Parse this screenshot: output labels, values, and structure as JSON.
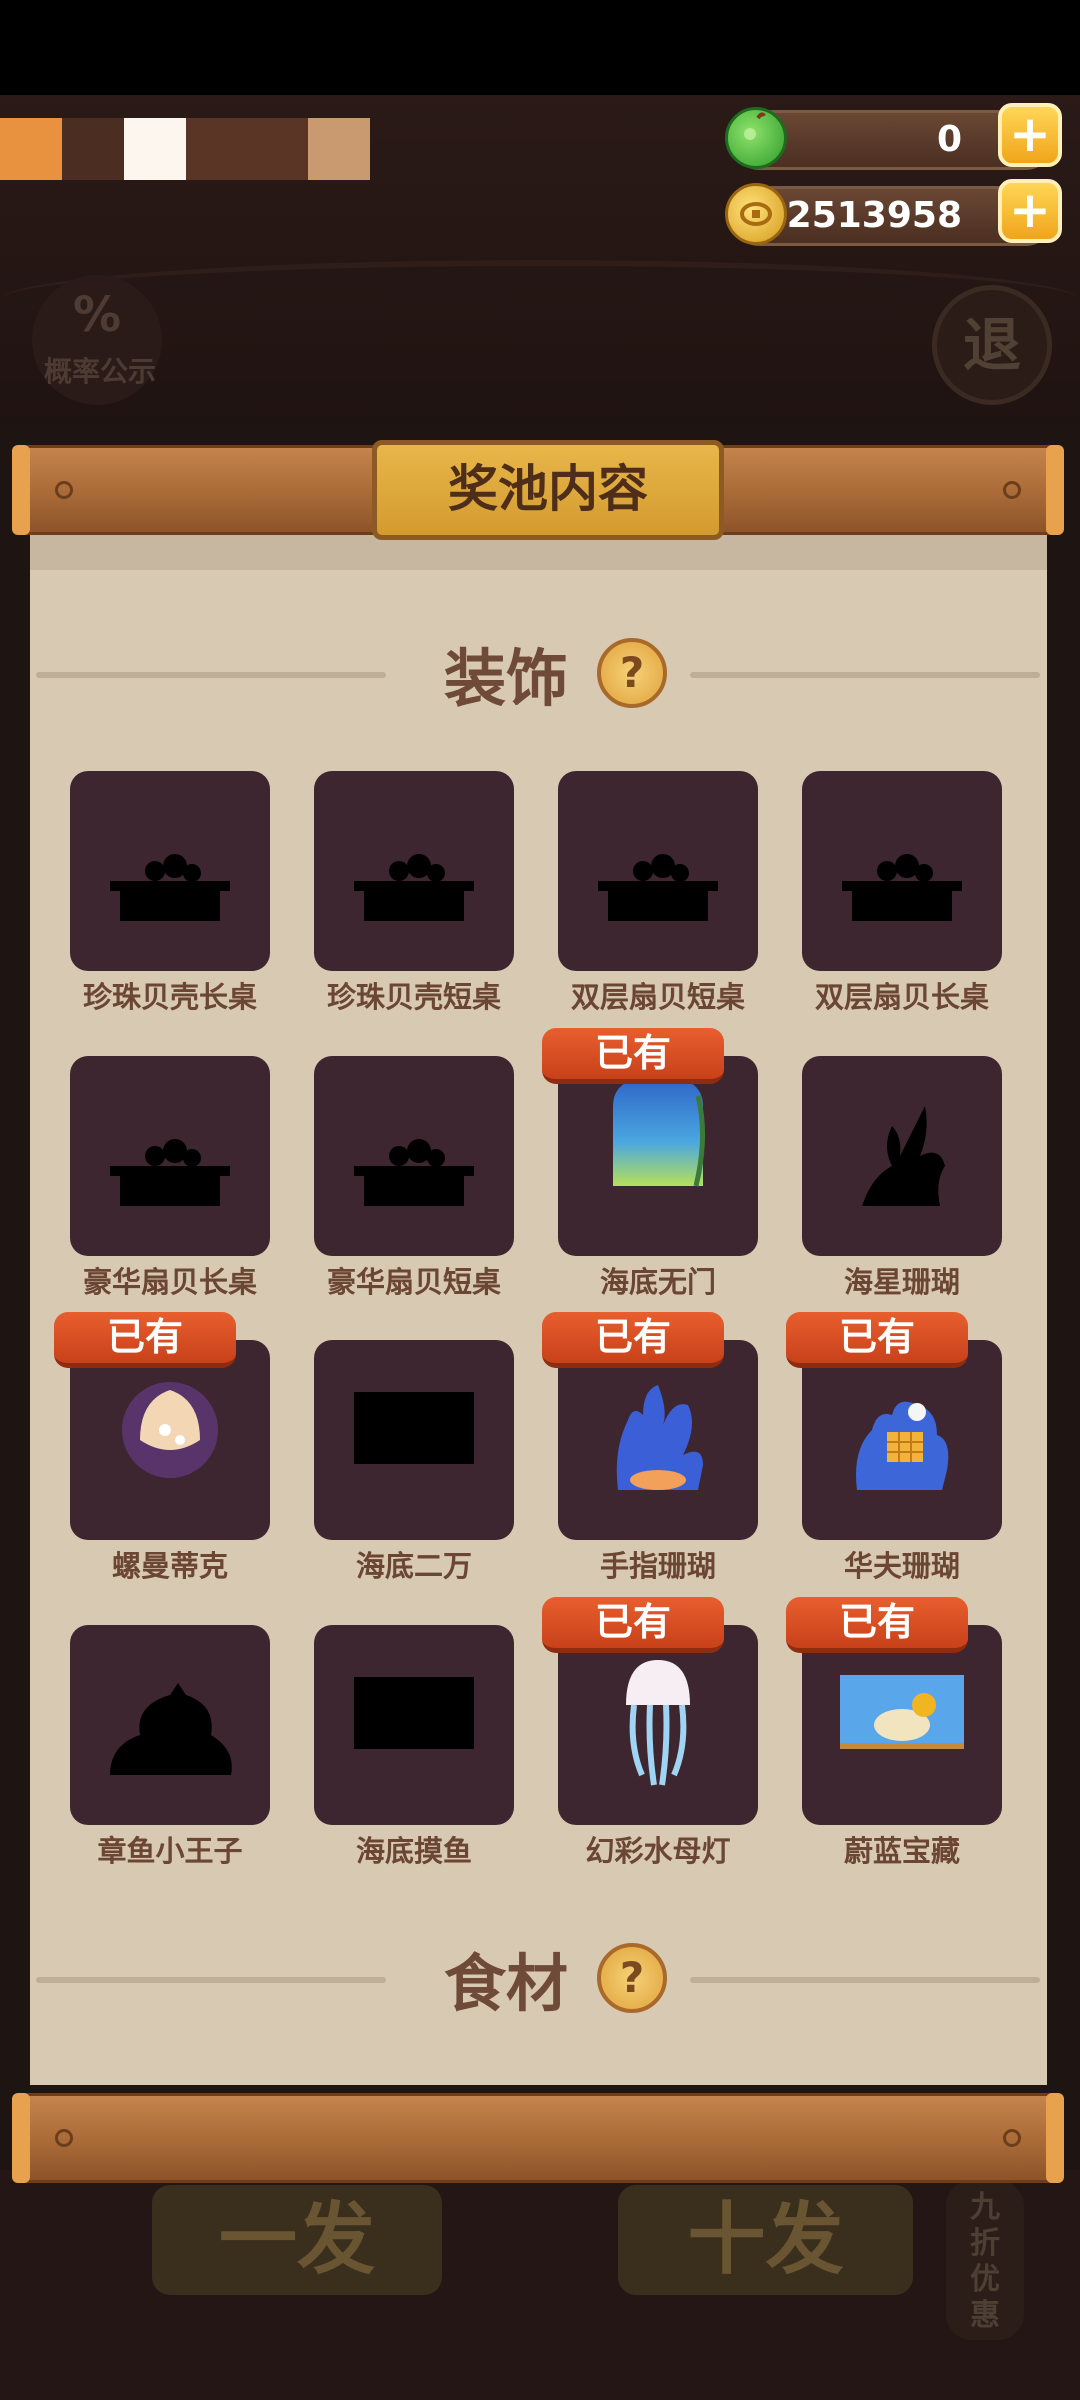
{
  "header": {
    "probability_label": "概率公示",
    "probability_symbol": "%",
    "exit_label": "退"
  },
  "color_swatches": [
    "#e8913f",
    "#4b2d22",
    "#fdf6ee",
    "#5a3425",
    "#c99a70"
  ],
  "currencies": {
    "gems": {
      "value": "0",
      "icon": "green-gem-icon"
    },
    "coins": {
      "value": "2513958",
      "icon": "gold-coin-icon"
    },
    "plus_label": "+"
  },
  "panel": {
    "title": "奖池内容",
    "owned_label": "已有",
    "help_symbol": "?",
    "sections": {
      "decor": {
        "title": "装饰",
        "items": [
          {
            "name": "珍珠贝壳长桌",
            "owned": false,
            "icon": "table-silhouette"
          },
          {
            "name": "珍珠贝壳短桌",
            "owned": false,
            "icon": "table-silhouette"
          },
          {
            "name": "双层扇贝短桌",
            "owned": false,
            "icon": "table-silhouette"
          },
          {
            "name": "双层扇贝长桌",
            "owned": false,
            "icon": "table-silhouette"
          },
          {
            "name": "豪华扇贝长桌",
            "owned": false,
            "icon": "table-silhouette"
          },
          {
            "name": "豪华扇贝短桌",
            "owned": false,
            "icon": "table-silhouette"
          },
          {
            "name": "海底无门",
            "owned": true,
            "icon": "ocean-door"
          },
          {
            "name": "海星珊瑚",
            "owned": false,
            "icon": "coral-silhouette"
          },
          {
            "name": "螺曼蒂克",
            "owned": true,
            "icon": "shell"
          },
          {
            "name": "海底二万",
            "owned": false,
            "icon": "rect-silhouette"
          },
          {
            "name": "手指珊瑚",
            "owned": true,
            "icon": "finger-coral"
          },
          {
            "name": "华夫珊瑚",
            "owned": true,
            "icon": "waffle-coral"
          },
          {
            "name": "章鱼小王子",
            "owned": false,
            "icon": "octopus-silhouette"
          },
          {
            "name": "海底摸鱼",
            "owned": false,
            "icon": "rect-silhouette"
          },
          {
            "name": "幻彩水母灯",
            "owned": true,
            "icon": "jellyfish-lamp"
          },
          {
            "name": "蔚蓝宝藏",
            "owned": true,
            "icon": "treasure-painting"
          }
        ]
      },
      "ingredients": {
        "title": "食材"
      }
    }
  },
  "bottom": {
    "single_draw": "一发",
    "ten_draw": "十发",
    "discount": "九折优惠"
  }
}
